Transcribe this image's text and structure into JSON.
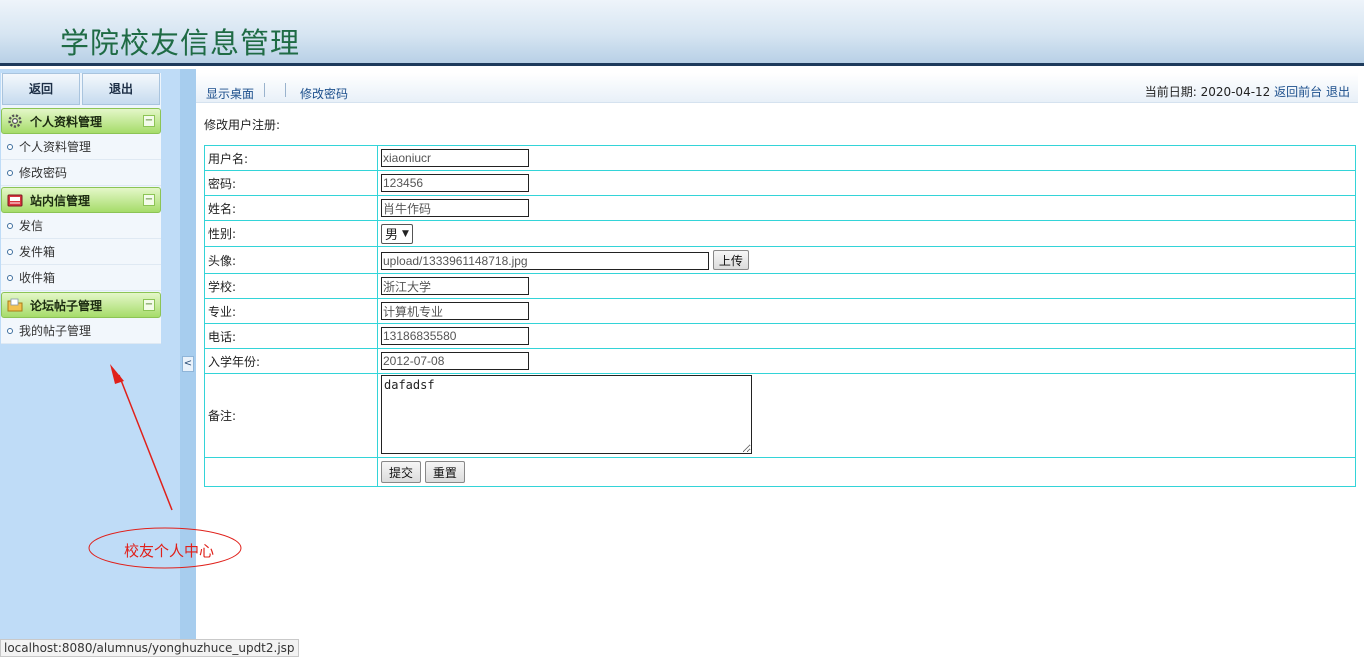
{
  "header": {
    "title": "学院校友信息管理"
  },
  "sidebar": {
    "back_label": "返回",
    "logout_label": "退出",
    "groups": [
      {
        "title": "个人资料管理",
        "icon": "gear-icon",
        "items": [
          {
            "label": "个人资料管理"
          },
          {
            "label": "修改密码"
          }
        ]
      },
      {
        "title": "站内信管理",
        "icon": "mailbox-icon",
        "items": [
          {
            "label": "发信"
          },
          {
            "label": "发件箱"
          },
          {
            "label": "收件箱"
          }
        ]
      },
      {
        "title": "论坛帖子管理",
        "icon": "folder-icon",
        "items": [
          {
            "label": "我的帖子管理"
          }
        ]
      }
    ],
    "toggle_symbol": "−",
    "collapse_symbol": "<"
  },
  "topnav": {
    "links": [
      {
        "label": "显示桌面"
      },
      {
        "label": "修改密码"
      }
    ],
    "date_label": "当前日期:",
    "date_value": "2020-04-12",
    "home_link": "返回前台",
    "logout_link": "退出"
  },
  "form": {
    "caption": "修改用户注册:",
    "username": {
      "label": "用户名:",
      "value": "xiaoniucr"
    },
    "password": {
      "label": "密码:",
      "value": "123456"
    },
    "name": {
      "label": "姓名:",
      "value": "肖牛作码"
    },
    "gender": {
      "label": "性别:",
      "value": "男",
      "arrow": "▼"
    },
    "avatar": {
      "label": "头像:",
      "value": "upload/1333961148718.jpg",
      "upload_label": "上传"
    },
    "school": {
      "label": "学校:",
      "value": "浙江大学"
    },
    "major": {
      "label": "专业:",
      "value": "计算机专业"
    },
    "phone": {
      "label": "电话:",
      "value": "13186835580"
    },
    "enroll_year": {
      "label": "入学年份:",
      "value": "2012-07-08"
    },
    "remark": {
      "label": "备注:",
      "value": "dafadsf"
    },
    "submit_label": "提交",
    "reset_label": "重置"
  },
  "annotation": {
    "text": "校友个人中心",
    "color": "#e0201a"
  },
  "status_bar": {
    "url": "localhost:8080/alumnus/yonghuzhuce_updt2.jsp"
  }
}
